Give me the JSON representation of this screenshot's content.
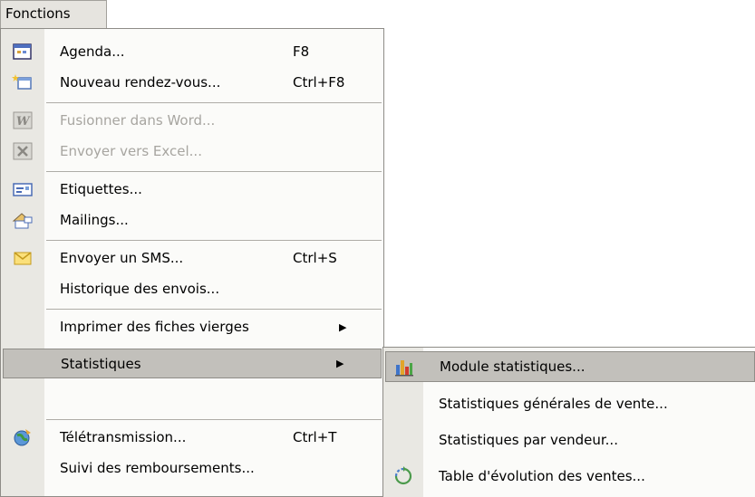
{
  "menubar": {
    "label": "Fonctions"
  },
  "menu": {
    "items": [
      {
        "label": "Agenda...",
        "shortcut": "F8",
        "icon": "calendar-icon"
      },
      {
        "label": "Nouveau rendez-vous...",
        "shortcut": "Ctrl+F8",
        "icon": "new-appointment-icon"
      },
      {
        "label": "Fusionner dans Word...",
        "shortcut": "",
        "icon": "word-icon"
      },
      {
        "label": "Envoyer vers Excel...",
        "shortcut": "",
        "icon": "excel-icon"
      },
      {
        "label": "Etiquettes...",
        "shortcut": "",
        "icon": "labels-icon"
      },
      {
        "label": "Mailings...",
        "shortcut": "",
        "icon": "mailing-icon"
      },
      {
        "label": "Envoyer un SMS...",
        "shortcut": "Ctrl+S",
        "icon": "envelope-icon"
      },
      {
        "label": "Historique des envois...",
        "shortcut": "",
        "icon": ""
      },
      {
        "label": "Statistiques",
        "shortcut": "",
        "icon": ""
      },
      {
        "label": "Imprimer des fiches vierges",
        "shortcut": "",
        "icon": ""
      },
      {
        "label": "Télétransmission...",
        "shortcut": "Ctrl+T",
        "icon": "globe-transmission-icon"
      },
      {
        "label": "Suivi des remboursements...",
        "shortcut": "",
        "icon": ""
      }
    ],
    "submenu_arrow": "▶"
  },
  "submenu": {
    "items": [
      {
        "label": "Module statistiques...",
        "icon": "bar-chart-icon"
      },
      {
        "label": "Statistiques générales de vente...",
        "icon": ""
      },
      {
        "label": "Statistiques par vendeur...",
        "icon": ""
      },
      {
        "label": "Table d'évolution des ventes...",
        "icon": "table-evolution-icon"
      }
    ]
  },
  "colors": {
    "highlight": "#c2c0bb",
    "gutter": "#e9e8e3",
    "disabled_text": "#a7a5a0"
  }
}
